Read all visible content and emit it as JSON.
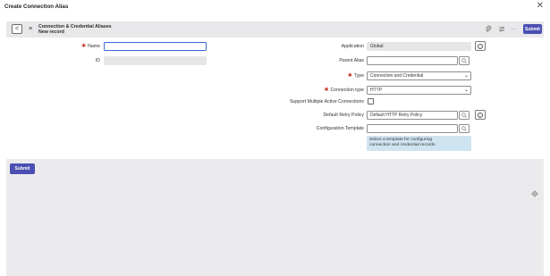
{
  "modal": {
    "title": "Create Connection Alias",
    "close_glyph": "✕"
  },
  "header": {
    "back_glyph": "<",
    "menu_glyph": "≡",
    "title": "Connection & Credential Aliases",
    "subtitle": "New record",
    "attach_icon": "paperclip-icon",
    "settings_icon": "sliders-icon",
    "more_icon": "more-icon",
    "attach_glyph": "⌀",
    "settings_glyph": "≑",
    "more_glyph": "···",
    "submit_label": "Submit"
  },
  "form": {
    "name": {
      "label": "Name",
      "required_mark": "✱",
      "value": ""
    },
    "id": {
      "label": "ID",
      "value": ""
    },
    "application": {
      "label": "Application",
      "value": "Global"
    },
    "parent_alias": {
      "label": "Parent Alias",
      "value": ""
    },
    "type": {
      "label": "Type",
      "required_mark": "✱",
      "value": "Connection and Credential"
    },
    "connection_type": {
      "label": "Connection type",
      "required_mark": "✱",
      "value": "HTTP"
    },
    "support_multiple": {
      "label": "Support Multiple Active Connections",
      "checked": false
    },
    "default_retry_policy": {
      "label": "Default Retry Policy",
      "value": "Default HTTP Retry Policy"
    },
    "configuration_template": {
      "label": "Configuration Template",
      "value": "",
      "help_line1": "Select a template for configuring",
      "help_line2": "connection and credential records."
    }
  },
  "footer": {
    "submit_label": "Submit",
    "gear_icon": "gear-icon",
    "gear_glyph": "⚙"
  },
  "icons": {
    "search": "🔍︎",
    "info": "i",
    "chevron": "⌄"
  },
  "colors": {
    "primary": "#4b4fb2",
    "required": "#c0392b",
    "help_bg": "#cfe4f1",
    "header_bg": "#e8e8ea"
  }
}
